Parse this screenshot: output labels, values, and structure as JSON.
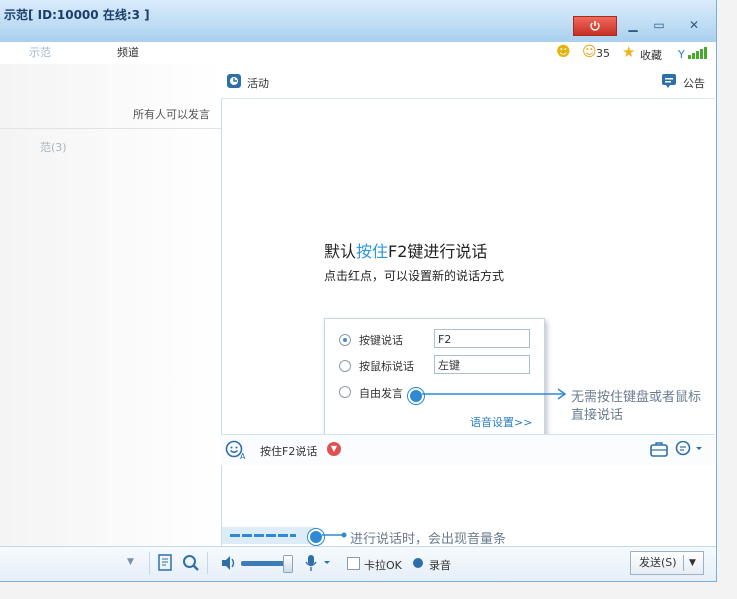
{
  "window": {
    "title": "示范[ ID:10000 在线:3 ]",
    "tabs": [
      {
        "label": "示范"
      },
      {
        "label": "频道"
      }
    ],
    "status": {
      "fans": "35",
      "favorite": "收藏"
    }
  },
  "main": {
    "activity": "活动",
    "notice": "公告",
    "left_header_note": "所有人可以发言",
    "left_group": "范(3)",
    "hint_line1_pre": "默认",
    "hint_line1_highlight": "按住",
    "hint_line1_post": "F2键进行说话",
    "hint_line2": "点击红点，可以设置新的说话方式",
    "highlight_color": "#2a97e0"
  },
  "popup": {
    "options": [
      {
        "label": "按键说话",
        "value": "F2",
        "selected": true
      },
      {
        "label": "按鼠标说话",
        "value": "左键",
        "selected": false
      },
      {
        "label": "自由发言",
        "selected": false
      }
    ],
    "settings_link": "语音设置>>"
  },
  "callouts": {
    "free_speech_line1": "无需按住键盘或者鼠标",
    "free_speech_line2": "直接说话",
    "volume_bar": "进行说话时，会出现音量条"
  },
  "input": {
    "mode_label": "按住F2说话"
  },
  "bottom": {
    "karaoke": "卡拉OK",
    "record": "录音",
    "send": "发送(S)"
  }
}
